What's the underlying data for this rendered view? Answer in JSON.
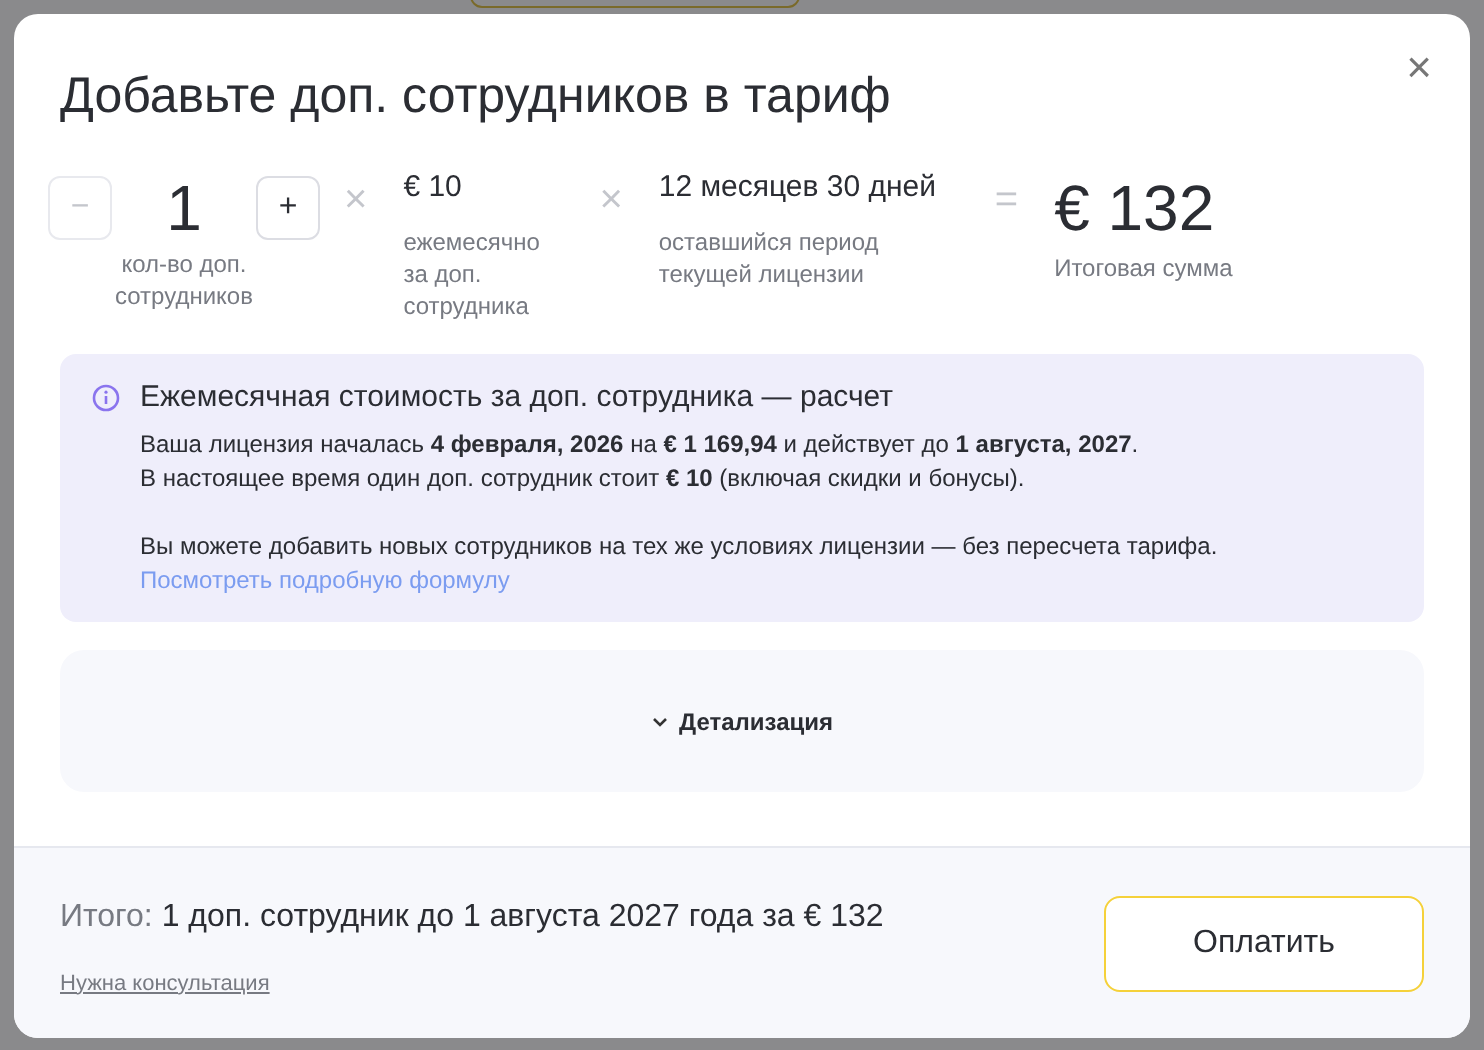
{
  "dialog": {
    "title": "Добавьте доп. сотрудников в тариф",
    "close": "×"
  },
  "calculator": {
    "stepper": {
      "minus": {
        "label": "−",
        "disabled": true
      },
      "value": "1",
      "plus": {
        "label": "+",
        "disabled": false
      },
      "caption": "кол-во доп. сотрудников"
    },
    "operators": [
      "×",
      "×",
      "="
    ],
    "price": {
      "value": "€ 10",
      "caption": "ежемесячно за доп. сотрудника"
    },
    "period": {
      "value": "12 месяцев 30 дней",
      "caption": "оставшийся период текущей лицензии"
    },
    "total": {
      "value": "€ 132",
      "caption": "Итоговая сумма"
    }
  },
  "info": {
    "title": "Ежемесячная стоимость за доп. сотрудника — расчет",
    "lines": [
      "Ваша лицензия началась **4 февраля, 2026** на **€ 1 169,94** и действует до **1 августа, 2027**.",
      "В настоящее время один доп. сотрудник стоит **€ 10** (включая скидки и бонусы)."
    ],
    "note": "Вы можете добавить новых сотрудников на тех же условиях лицензии — без пересчета тарифа.",
    "link": "Посмотреть подробную формулу"
  },
  "details": {
    "label": "Детализация",
    "expanded": false
  },
  "footer": {
    "summary_label": "Итого:",
    "summary": "1 доп. сотрудник до 1 августа 2027 года за € 132",
    "help_link": "Нужна консультация",
    "pay_button": "Оплатить"
  }
}
